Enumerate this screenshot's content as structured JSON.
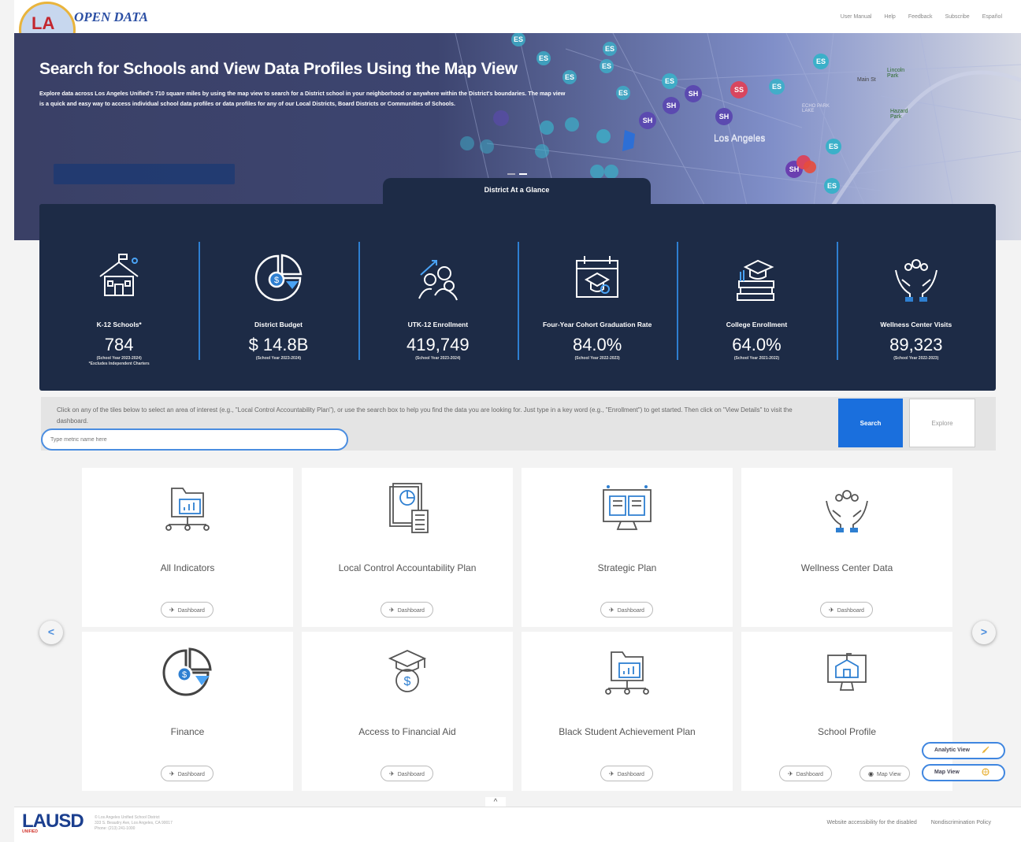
{
  "header": {
    "logo_text": "LA",
    "brand": "OPEN DATA",
    "nav": [
      "User Manual",
      "Help",
      "Feedback",
      "Subscribe",
      "Español"
    ]
  },
  "hero": {
    "title": "Search for Schools and View Data Profiles Using the Map View",
    "description": "Explore data across Los Angeles Unified's 710 square miles by using the map view to search for a District school in your neighborhood or anywhere within the District's boundaries. The map view is a quick and easy way to access individual school data profiles or data profiles for any of our Local Districts, Board Districts or Communities of Schools.",
    "map_labels": {
      "city": "Los Angeles",
      "main_st": "Main St",
      "lincoln_park": "Lincoln Park",
      "echo_park_lake": "ECHO PARK LAKE",
      "hazard_park": "Hazard Park"
    }
  },
  "glance": {
    "tab_label": "District At a Glance",
    "stats": [
      {
        "label": "K-12 Schools*",
        "value": "784",
        "note": "(School Year 2023-2024)",
        "note2": "*Excludes Independent Charters",
        "icon": "school-icon"
      },
      {
        "label": "District Budget",
        "value": "$ 14.8B",
        "note": "(School Year 2023-2024)",
        "note2": "",
        "icon": "budget-pie-icon"
      },
      {
        "label": "UTK-12 Enrollment",
        "value": "419,749",
        "note": "(School Year 2023-2024)",
        "note2": "",
        "icon": "students-growth-icon"
      },
      {
        "label": "Four-Year Cohort Graduation Rate",
        "value": "84.0%",
        "note": "(School Year 2022-2023)",
        "note2": "",
        "icon": "graduation-calendar-icon"
      },
      {
        "label": "College Enrollment",
        "value": "64.0%",
        "note": "(School Year 2021-2022)",
        "note2": "",
        "icon": "books-cap-icon"
      },
      {
        "label": "Wellness Center Visits",
        "value": "89,323",
        "note": "(School Year 2022-2023)",
        "note2": "",
        "icon": "care-hands-icon"
      }
    ]
  },
  "search": {
    "help_text": "Click on any of the tiles below to select an area of interest (e.g., \"Local Control Accountability Plan\"), or use the search box to help you find the data you are looking for. Just type in a key word (e.g., \"Enrollment\") to get started. Then click on \"View Details\" to visit the dashboard.",
    "placeholder": "Type metric name here",
    "search_label": "Search",
    "explore_label": "Explore"
  },
  "cards": [
    {
      "title": "All Indicators",
      "icon": "folder-network-icon",
      "buttons": [
        "Dashboard"
      ]
    },
    {
      "title": "Local Control Accountability Plan",
      "icon": "report-calculator-icon",
      "buttons": [
        "Dashboard"
      ]
    },
    {
      "title": "Strategic Plan",
      "icon": "monitor-book-icon",
      "buttons": [
        "Dashboard"
      ]
    },
    {
      "title": "Wellness Center Data",
      "icon": "care-hands-icon",
      "buttons": [
        "Dashboard"
      ]
    },
    {
      "title": "Finance",
      "icon": "budget-pie-icon",
      "buttons": [
        "Dashboard"
      ]
    },
    {
      "title": "Access to Financial Aid",
      "icon": "graduation-money-icon",
      "buttons": [
        "Dashboard"
      ]
    },
    {
      "title": "Black Student Achievement Plan",
      "icon": "folder-network-icon",
      "buttons": [
        "Dashboard"
      ]
    },
    {
      "title": "School Profile",
      "icon": "monitor-school-icon",
      "buttons": [
        "Dashboard",
        "Map View"
      ]
    }
  ],
  "floating": {
    "analytic_view": "Analytic View",
    "map_view": "Map View"
  },
  "footer": {
    "logo_main": "LAUSD",
    "logo_sub": "UNIFIED",
    "address_line1": "© Los Angeles Unified School District",
    "address_line2": "333 S. Beaudry Ave, Los Angeles, CA 90017",
    "address_line3": "Phone: (213) 241-1000",
    "links": [
      "Website accessibility for the disabled",
      "Nondiscrimination Policy"
    ]
  },
  "colors": {
    "navy": "#1d2b46",
    "accent_blue": "#1a6fdd",
    "divider_blue": "#2e7fd1"
  }
}
